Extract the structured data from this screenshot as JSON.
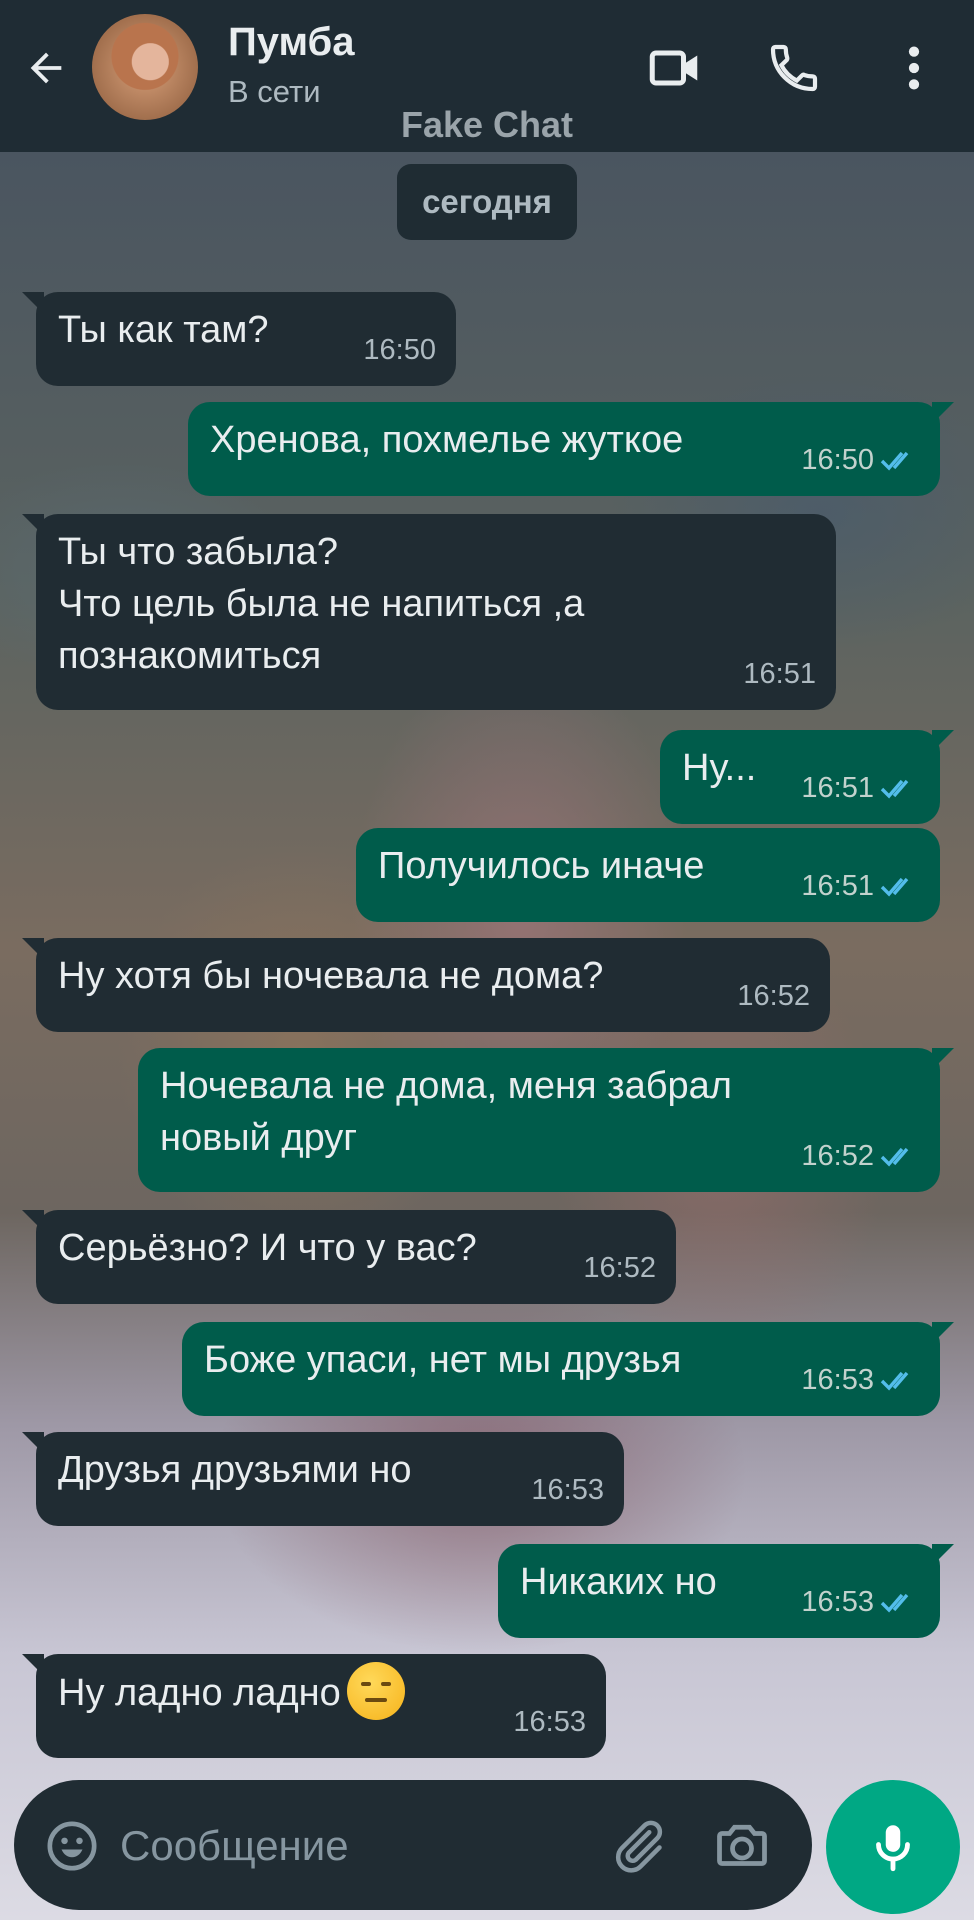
{
  "header": {
    "contact_name": "Пумба",
    "status": "В сети",
    "watermark": "Fake Chat",
    "icons": [
      "back-arrow-icon",
      "video-call-icon",
      "phone-icon",
      "more-vert-icon"
    ]
  },
  "date_separator": "сегодня",
  "messages": [
    {
      "direction": "in",
      "text": "Ты как там?",
      "time": "16:50"
    },
    {
      "direction": "out",
      "text": "Хренова, похмелье жуткое",
      "time": "16:50",
      "read": true
    },
    {
      "direction": "in",
      "text": "Ты что забыла?\nЧто цель была не напиться ,а\nпознакомиться",
      "time": "16:51"
    },
    {
      "direction": "out",
      "text": "Ну...",
      "time": "16:51",
      "read": true
    },
    {
      "direction": "out",
      "text": "Получилось иначе",
      "time": "16:51",
      "read": true
    },
    {
      "direction": "in",
      "text": "Ну хотя бы ночевала не дома?",
      "time": "16:52"
    },
    {
      "direction": "out",
      "text": "Ночевала не дома, меня забрал\nновый друг",
      "time": "16:52",
      "read": true
    },
    {
      "direction": "in",
      "text": "Серьёзно? И что у вас?",
      "time": "16:52"
    },
    {
      "direction": "out",
      "text": "Боже упаси, нет мы друзья",
      "time": "16:53",
      "read": true
    },
    {
      "direction": "in",
      "text": "Друзья друзьями но",
      "time": "16:53"
    },
    {
      "direction": "out",
      "text": "Никаких но",
      "time": "16:53",
      "read": true
    },
    {
      "direction": "in",
      "text": "Ну ладно ладно",
      "time": "16:53",
      "emoji": "expressionless-face"
    }
  ],
  "composer": {
    "placeholder": "Сообщение",
    "icons": [
      "emoji-icon",
      "attach-icon",
      "camera-icon",
      "mic-icon"
    ]
  },
  "colors": {
    "header_bg": "#1f2c34",
    "incoming_bubble": "#202c33",
    "outgoing_bubble": "#005c4b",
    "read_ticks": "#53bdeb",
    "mic_button": "#00a884"
  }
}
